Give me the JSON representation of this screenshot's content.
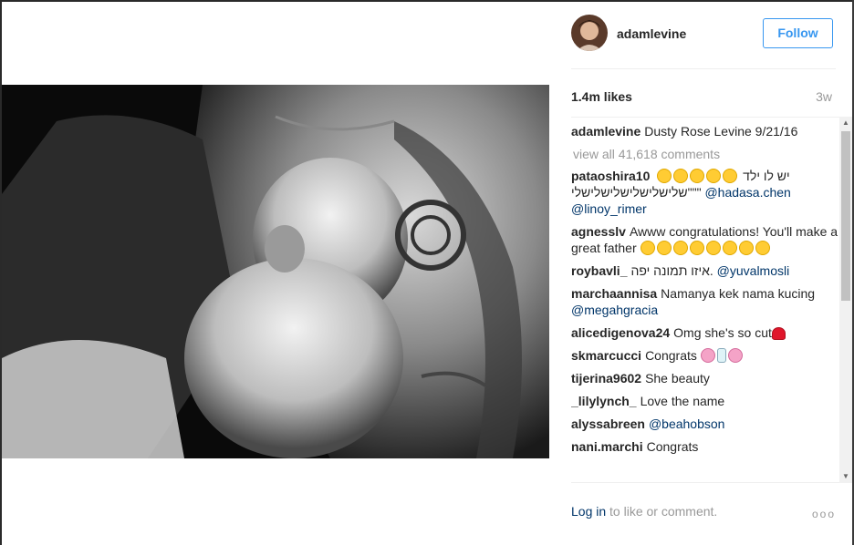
{
  "post": {
    "username": "adamlevine",
    "follow_label": "Follow",
    "likes": "1.4m likes",
    "age": "3w",
    "view_all": "view all 41,618 comments"
  },
  "caption": {
    "user": "adamlevine",
    "text": "Dusty Rose Levine 9/21/16"
  },
  "comments": [
    {
      "user": "pataoshira10",
      "text": "יש לו ילד",
      "text2": "שלישלישלישלישלישלי\"\"\"",
      "mention": "@hadasa.chen",
      "mention2": "@linoy_rimer"
    },
    {
      "user": "agnesslv",
      "text": "Awww congratulations! You'll make a great father"
    },
    {
      "user": "roybavli_",
      "text": "איזו תמונה יפה.",
      "mention": "@yuvalmosli"
    },
    {
      "user": "marchaannisa",
      "text": "Namanya kek nama kucing",
      "mention": "@megahgracia"
    },
    {
      "user": "alicedigenova24",
      "text": "Omg she's so cut"
    },
    {
      "user": "skmarcucci",
      "text": "Congrats"
    },
    {
      "user": "tijerina9602",
      "text": "She beauty"
    },
    {
      "user": "_lilylynch_",
      "text": "Love the name"
    },
    {
      "user": "alyssabreen",
      "text": "",
      "mention": "@beahobson"
    },
    {
      "user": "nani.marchi",
      "text": "Congrats"
    }
  ],
  "footer": {
    "login": "Log in",
    "rest": "to like or comment.",
    "more": "ooo"
  },
  "colors": {
    "accent": "#3897f0",
    "link": "#003569",
    "muted": "#999999"
  },
  "icons": [
    "heart-eyes-emoji",
    "wink-kiss-emoji",
    "red-heart-emoji",
    "cherry-blossom-emoji",
    "baby-bottle-emoji",
    "more-options-icon"
  ]
}
